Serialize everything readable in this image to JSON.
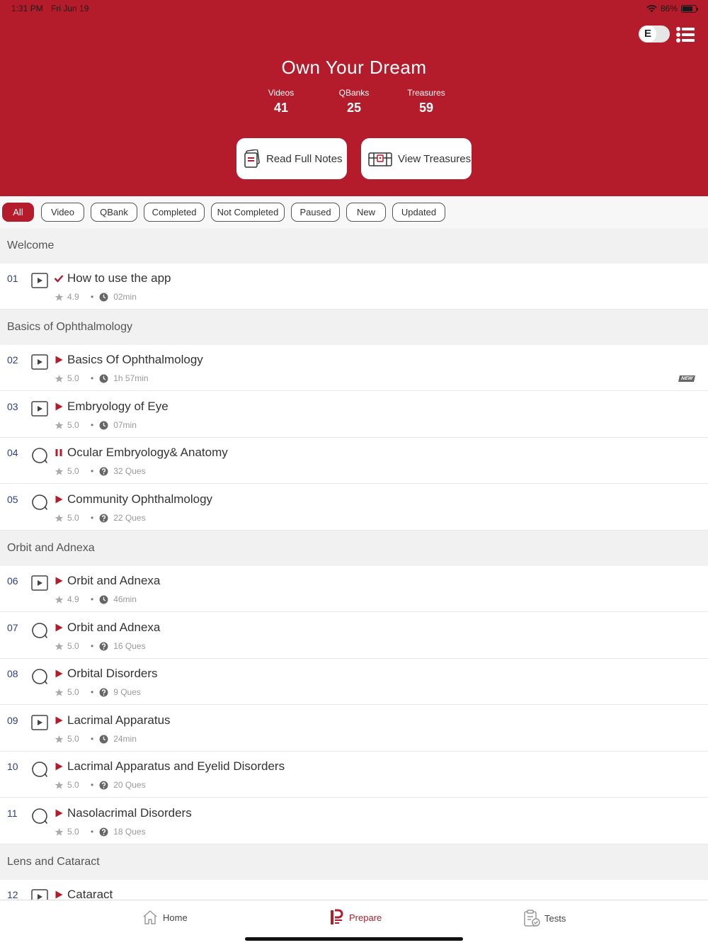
{
  "status": {
    "time": "1:31 PM",
    "date": "Fri Jun 19",
    "battery": "86%"
  },
  "header": {
    "toggle_letter": "E",
    "title": "Own Your Dream",
    "stats": [
      {
        "label": "Videos",
        "value": "41"
      },
      {
        "label": "QBanks",
        "value": "25"
      },
      {
        "label": "Treasures",
        "value": "59"
      }
    ],
    "read_notes_label": "Read Full Notes",
    "view_treasures_label": "View Treasures"
  },
  "filters": [
    "All",
    "Video",
    "QBank",
    "Completed",
    "Not Completed",
    "Paused",
    "New",
    "Updated"
  ],
  "active_filter": "All",
  "sections": [
    {
      "title": "Welcome"
    },
    {
      "title": "Basics of Ophthalmology"
    },
    {
      "title": "Orbit and Adnexa"
    },
    {
      "title": "Lens and Cataract"
    }
  ],
  "items": [
    {
      "num": "01",
      "type": "video",
      "state": "completed",
      "title": "How to use the app",
      "rating": "4.9",
      "meta_kind": "time",
      "meta": "02min"
    },
    {
      "num": "02",
      "type": "video",
      "state": "play",
      "title": "Basics Of Ophthalmology",
      "rating": "5.0",
      "meta_kind": "time",
      "meta": "1h 57min",
      "badge": "NEW"
    },
    {
      "num": "03",
      "type": "video",
      "state": "play",
      "title": "Embryology of Eye",
      "rating": "5.0",
      "meta_kind": "time",
      "meta": "07min"
    },
    {
      "num": "04",
      "type": "qbank",
      "state": "paused",
      "title": "Ocular Embryology& Anatomy",
      "rating": "5.0",
      "meta_kind": "ques",
      "meta": "32 Ques"
    },
    {
      "num": "05",
      "type": "qbank",
      "state": "play",
      "title": "Community Ophthalmology",
      "rating": "5.0",
      "meta_kind": "ques",
      "meta": "22 Ques"
    },
    {
      "num": "06",
      "type": "video",
      "state": "play",
      "title": "Orbit and Adnexa",
      "rating": "4.9",
      "meta_kind": "time",
      "meta": "46min"
    },
    {
      "num": "07",
      "type": "qbank",
      "state": "play",
      "title": "Orbit and Adnexa",
      "rating": "5.0",
      "meta_kind": "ques",
      "meta": "16 Ques"
    },
    {
      "num": "08",
      "type": "qbank",
      "state": "play",
      "title": "Orbital Disorders",
      "rating": "5.0",
      "meta_kind": "ques",
      "meta": "9 Ques"
    },
    {
      "num": "09",
      "type": "video",
      "state": "play",
      "title": "Lacrimal Apparatus",
      "rating": "5.0",
      "meta_kind": "time",
      "meta": "24min"
    },
    {
      "num": "10",
      "type": "qbank",
      "state": "play",
      "title": "Lacrimal Apparatus and Eyelid Disorders",
      "rating": "5.0",
      "meta_kind": "ques",
      "meta": "20 Ques"
    },
    {
      "num": "11",
      "type": "qbank",
      "state": "play",
      "title": "Nasolacrimal Disorders",
      "rating": "5.0",
      "meta_kind": "ques",
      "meta": "18 Ques"
    },
    {
      "num": "12",
      "type": "video",
      "state": "play",
      "title": "Cataract"
    }
  ],
  "nav": {
    "home": "Home",
    "prepare": "Prepare",
    "tests": "Tests"
  },
  "colors": {
    "brand": "#b51c2b",
    "number": "#2c3e8c"
  }
}
